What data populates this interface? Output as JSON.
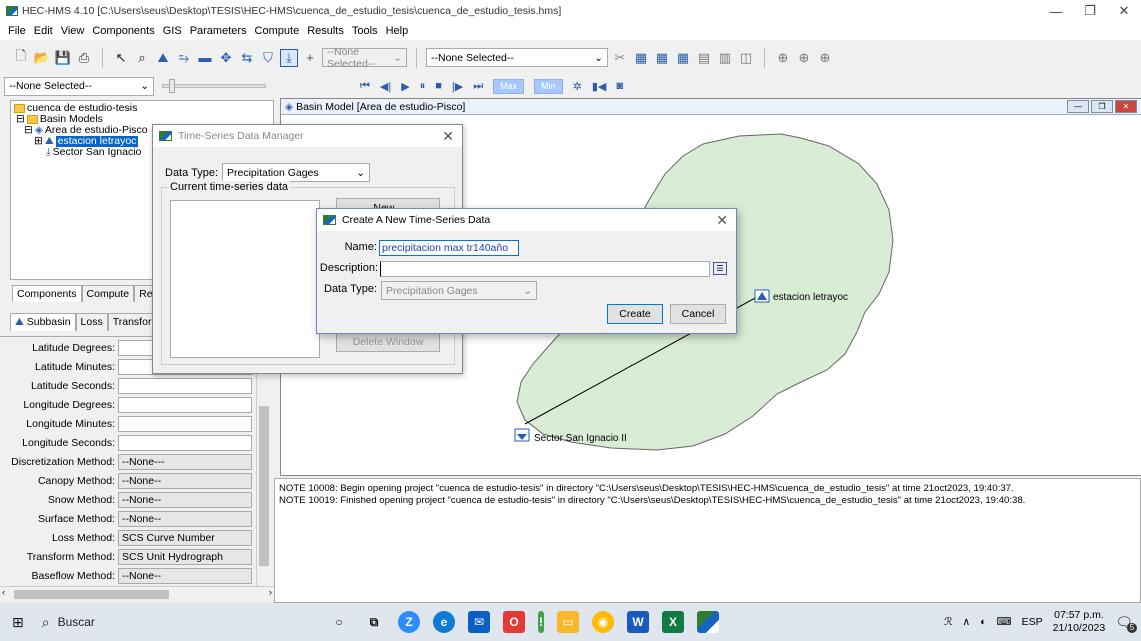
{
  "window": {
    "title": "HEC-HMS 4.10 [C:\\Users\\seus\\Desktop\\TESIS\\HEC-HMS\\cuenca_de_estudio_tesis\\cuenca_de_estudio_tesis.hms]"
  },
  "menu": [
    "File",
    "Edit",
    "View",
    "Components",
    "GIS",
    "Parameters",
    "Compute",
    "Results",
    "Tools",
    "Help"
  ],
  "toolbar": {
    "select1": "--None Selected--",
    "select2": "--None Selected--",
    "select3": "--None Selected--",
    "max_label": "Max",
    "min_label": "Min"
  },
  "tree": {
    "root": "cuenca de estudio-tesis",
    "basin_models": "Basin Models",
    "basin": "Area de estudio-Pisco",
    "station": "estacion letrayoc",
    "sector": "Sector San Ignacio"
  },
  "panel_tabs": [
    "Components",
    "Compute",
    "Resu"
  ],
  "sub_tabs": [
    "Subbasin",
    "Loss",
    "Transform"
  ],
  "properties": [
    {
      "label": "Latitude Degrees:",
      "value": ""
    },
    {
      "label": "Latitude Minutes:",
      "value": ""
    },
    {
      "label": "Latitude Seconds:",
      "value": ""
    },
    {
      "label": "Longitude Degrees:",
      "value": ""
    },
    {
      "label": "Longitude Minutes:",
      "value": ""
    },
    {
      "label": "Longitude Seconds:",
      "value": ""
    },
    {
      "label": "Discretization Method:",
      "value": "--None---"
    },
    {
      "label": "Canopy Method:",
      "value": "--None--"
    },
    {
      "label": "Snow Method:",
      "value": "--None--"
    },
    {
      "label": "Surface Method:",
      "value": "--None--"
    },
    {
      "label": "Loss Method:",
      "value": "SCS Curve Number"
    },
    {
      "label": "Transform Method:",
      "value": "SCS Unit Hydrograph"
    },
    {
      "label": "Baseflow Method:",
      "value": "--None--"
    }
  ],
  "basin_window": {
    "title": "Basin Model [Area de estudio-Pisco]",
    "station_label": "estacion letrayoc",
    "sector_label": "Sector San Ignacio II"
  },
  "notes": [
    "NOTE 10008:  Begin opening project \"cuenca de estudio-tesis\" in directory \"C:\\Users\\seus\\Desktop\\TESIS\\HEC-HMS\\cuenca_de_estudio_tesis\" at time 21oct2023, 19:40:37.",
    "NOTE 10019:  Finished opening project \"cuenca de estudio-tesis\" in directory \"C:\\Users\\seus\\Desktop\\TESIS\\HEC-HMS\\cuenca_de_estudio_tesis\" at time 21oct2023, 19:40:38."
  ],
  "ts_manager": {
    "title": "Time-Series Data Manager",
    "data_type_label": "Data Type:",
    "data_type_value": "Precipitation Gages",
    "group_label": "Current time-series data",
    "new_button": "New...",
    "delete_window_button": "Delete Window"
  },
  "create_dialog": {
    "title": "Create A New Time-Series Data",
    "name_label": "Name:",
    "name_value": "precipitacion max tr140año",
    "description_label": "Description:",
    "description_value": "",
    "data_type_label": "Data Type:",
    "data_type_value": "Precipitation Gages",
    "create_button": "Create",
    "cancel_button": "Cancel"
  },
  "taskbar": {
    "search_placeholder": "Buscar",
    "lang": "ESP",
    "time": "07:57 p.m.",
    "date": "21/10/2023",
    "notif_count": "5"
  },
  "colors": {
    "basin_fill": "#d9ecd5",
    "selection": "#0a64c8",
    "accent": "#0078d7"
  }
}
